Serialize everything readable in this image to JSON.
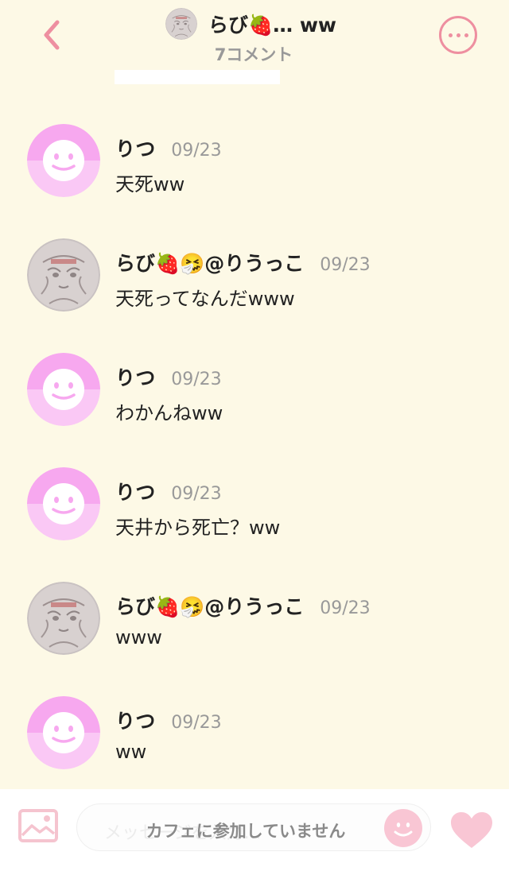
{
  "header": {
    "title": "らび🍓… ww",
    "subtitle": "7コメント",
    "back_icon": "chevron-left-icon",
    "more_icon": "more-dots-icon",
    "accent_color": "#EE8FA0"
  },
  "comments": [
    {
      "author": "りつ",
      "date": "09/23",
      "text": "天死ww",
      "avatar": "smiley-avatar"
    },
    {
      "author": "らび🍓🤧@りうっこ",
      "date": "09/23",
      "text": "天死ってなんだwww",
      "avatar": "photo-avatar"
    },
    {
      "author": "りつ",
      "date": "09/23",
      "text": "わかんねww",
      "avatar": "smiley-avatar"
    },
    {
      "author": "りつ",
      "date": "09/23",
      "text": "天井から死亡？ww",
      "avatar": "smiley-avatar"
    },
    {
      "author": "らび🍓🤧@りうっこ",
      "date": "09/23",
      "text": "www",
      "avatar": "photo-avatar"
    },
    {
      "author": "りつ",
      "date": "09/23",
      "text": "ww",
      "avatar": "smiley-avatar"
    }
  ],
  "composer": {
    "placeholder": "メッセージを入力…",
    "status": "カフェに参加していません",
    "image_icon": "image-icon",
    "stamp_icon": "stamp-icon",
    "heart_icon": "heart-icon"
  },
  "colors": {
    "background": "#FDF9E6",
    "avatar_pink": "#F5A8F0",
    "heart_pink": "#F9C6D4"
  }
}
